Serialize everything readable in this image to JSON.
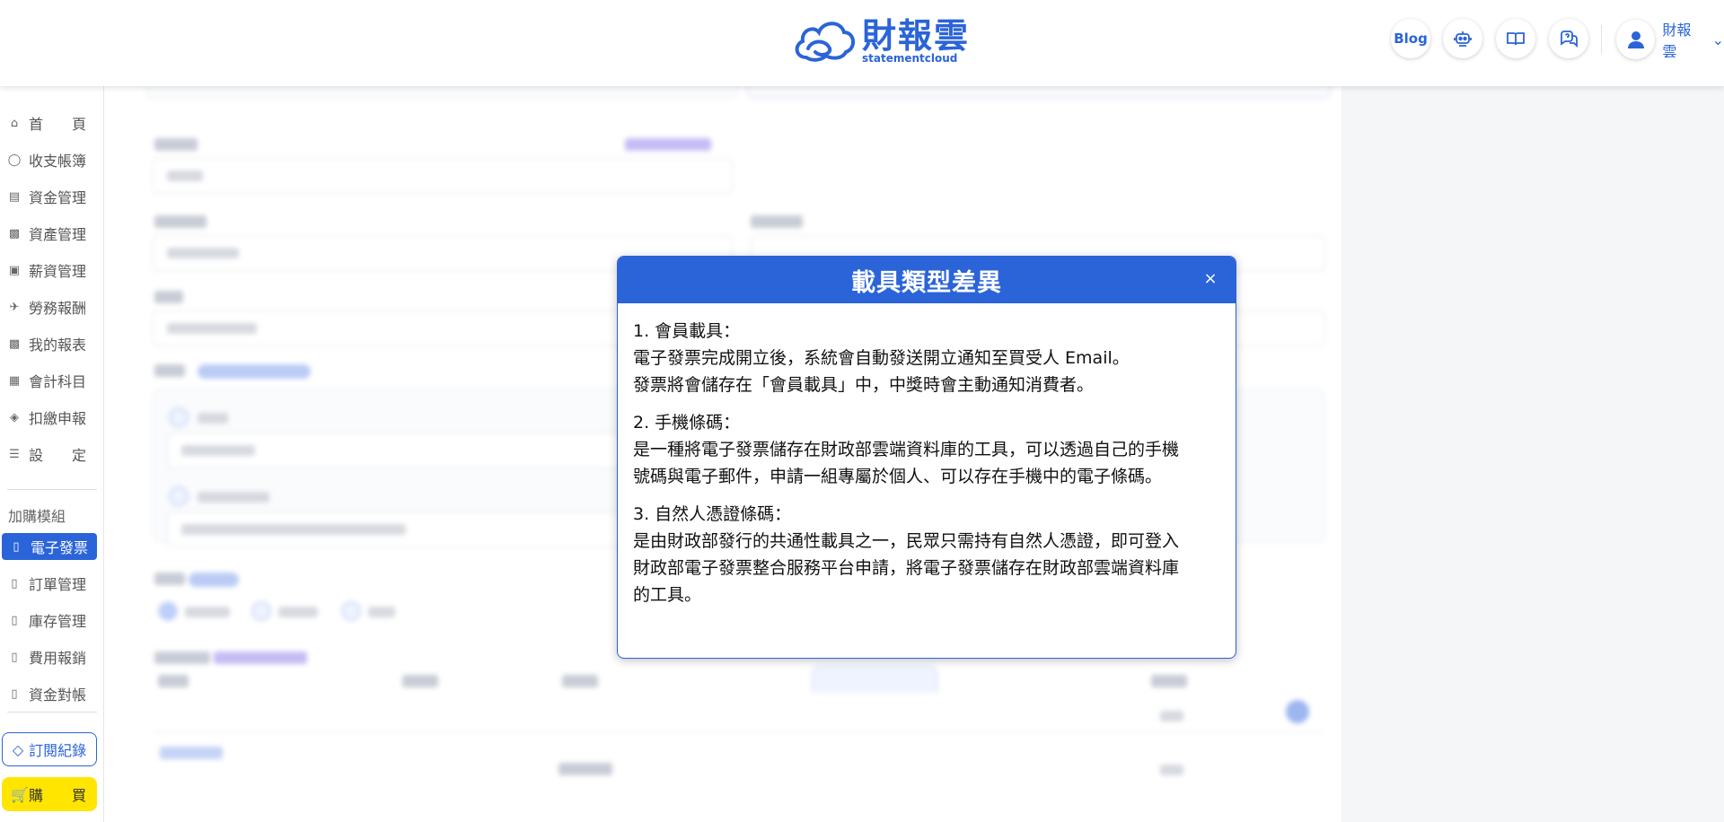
{
  "header": {
    "logo": {
      "name_cn": "財報雲",
      "name_en": "statementcloud"
    },
    "blog_label": "Blog",
    "icons": [
      "robot-support-icon",
      "book-icon",
      "chat-help-icon"
    ],
    "user_name": "財報雲"
  },
  "sidebar": {
    "items": [
      {
        "label": "首　　頁",
        "icon": "home-icon"
      },
      {
        "label": "收支帳簿",
        "icon": "money-icon"
      },
      {
        "label": "資金管理",
        "icon": "fund-icon"
      },
      {
        "label": "資產管理",
        "icon": "asset-icon"
      },
      {
        "label": "薪資管理",
        "icon": "salary-icon"
      },
      {
        "label": "勞務報酬",
        "icon": "labor-icon"
      },
      {
        "label": "我的報表",
        "icon": "chart-icon"
      },
      {
        "label": "會計科目",
        "icon": "ledger-icon"
      },
      {
        "label": "扣繳申報",
        "icon": "tax-icon"
      },
      {
        "label": "設　　定",
        "icon": "settings-icon"
      }
    ],
    "addon_title": "加購模組",
    "addon_items": [
      {
        "label": "電子發票",
        "active": true
      },
      {
        "label": "訂單管理",
        "active": false
      },
      {
        "label": "庫存管理",
        "active": false
      },
      {
        "label": "費用報銷",
        "active": false
      },
      {
        "label": "資金對帳",
        "active": false
      }
    ],
    "subscription_label": "訂閱紀錄",
    "buy_label": "購　　買"
  },
  "modal": {
    "title": "載具類型差異",
    "close_label": "×",
    "sections": [
      {
        "heading": "1. 會員載具：",
        "lines": [
          "電子發票完成開立後，系統會自動發送開立通知至買受人 Email。",
          "發票將會儲存在「會員載具」中，中獎時會主動通知消費者。"
        ]
      },
      {
        "heading": "2. 手機條碼：",
        "lines": [
          "是一種將電子發票儲存在財政部雲端資料庫的工具，可以透過自己的手機",
          "號碼與電子郵件，申請一組專屬於個人、可以存在手機中的電子條碼。"
        ]
      },
      {
        "heading": "3. 自然人憑證條碼：",
        "lines": [
          "是由財政部發行的共通性載具之一，民眾只需持有自然人憑證，即可登入",
          "財政部電子發票整合服務平台申請，將電子發票儲存在財政部雲端資料庫",
          "的工具。"
        ]
      }
    ]
  },
  "colors": {
    "brand": "#2a64d8",
    "buy": "#ffe500"
  }
}
